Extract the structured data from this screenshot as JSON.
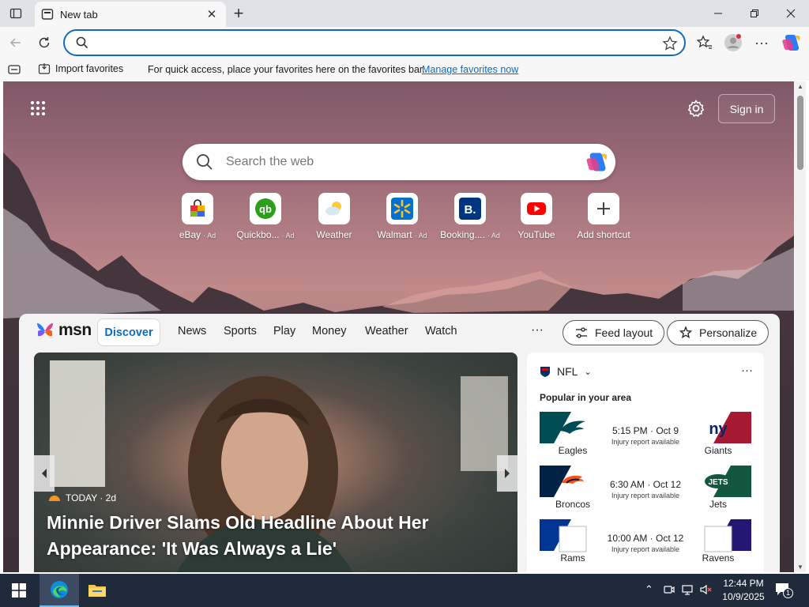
{
  "browser": {
    "tab_title": "New tab",
    "address": {
      "value": "",
      "placeholder": ""
    }
  },
  "favorites_bar": {
    "import_label": "Import favorites",
    "hint": "For quick access, place your favorites here on the favorites bar.",
    "manage_link": "Manage favorites now"
  },
  "newtab": {
    "signin_label": "Sign in",
    "search_placeholder": "Search the web",
    "shortcuts": [
      {
        "label": "eBay",
        "ad": "· Ad",
        "icon": "ebay-icon"
      },
      {
        "label": "Quickbo...",
        "ad": "· Ad",
        "icon": "quickbooks-icon",
        "color": "#2ca01c"
      },
      {
        "label": "Weather",
        "ad": "",
        "icon": "weather-icon"
      },
      {
        "label": "Walmart",
        "ad": "· Ad",
        "icon": "walmart-icon",
        "color": "#0071ce"
      },
      {
        "label": "Booking....",
        "ad": "· Ad",
        "icon": "booking-icon",
        "color": "#003580"
      },
      {
        "label": "YouTube",
        "ad": "",
        "icon": "youtube-icon",
        "color": "#ff0000"
      },
      {
        "label": "Add shortcut",
        "ad": "",
        "icon": "plus-icon"
      }
    ]
  },
  "feed": {
    "logo_text": "msn",
    "tabs": [
      "Discover",
      "News",
      "Sports",
      "Play",
      "Money",
      "Weather",
      "Watch"
    ],
    "more": "···",
    "feed_layout_label": "Feed layout",
    "personalize_label": "Personalize",
    "hero": {
      "source": "TODAY · 2d",
      "title": "Minnie Driver Slams Old Headline About Her Appearance: 'It Was Always a Lie'"
    }
  },
  "nfl": {
    "title": "NFL",
    "subtitle": "Popular in your area",
    "games": [
      {
        "home": "Eagles",
        "away": "Giants",
        "time": "5:15 PM · Oct 9",
        "note": "Injury report available",
        "left_color": "#004c54",
        "right_color": "#a71930"
      },
      {
        "home": "Broncos",
        "away": "Jets",
        "time": "6:30 AM · Oct 12",
        "note": "Injury report available",
        "left_color": "#002244",
        "right_color": "#125740"
      },
      {
        "home": "Rams",
        "away": "Ravens",
        "time": "10:00 AM · Oct 12",
        "note": "Injury report available",
        "left_color": "#003594",
        "right_color": "#241773"
      }
    ]
  },
  "taskbar": {
    "time": "12:44 PM",
    "date": "10/9/2025",
    "notification_count": "1"
  },
  "colors": {
    "accent": "#0f6cbd",
    "taskbar": "#1f2a3a"
  }
}
